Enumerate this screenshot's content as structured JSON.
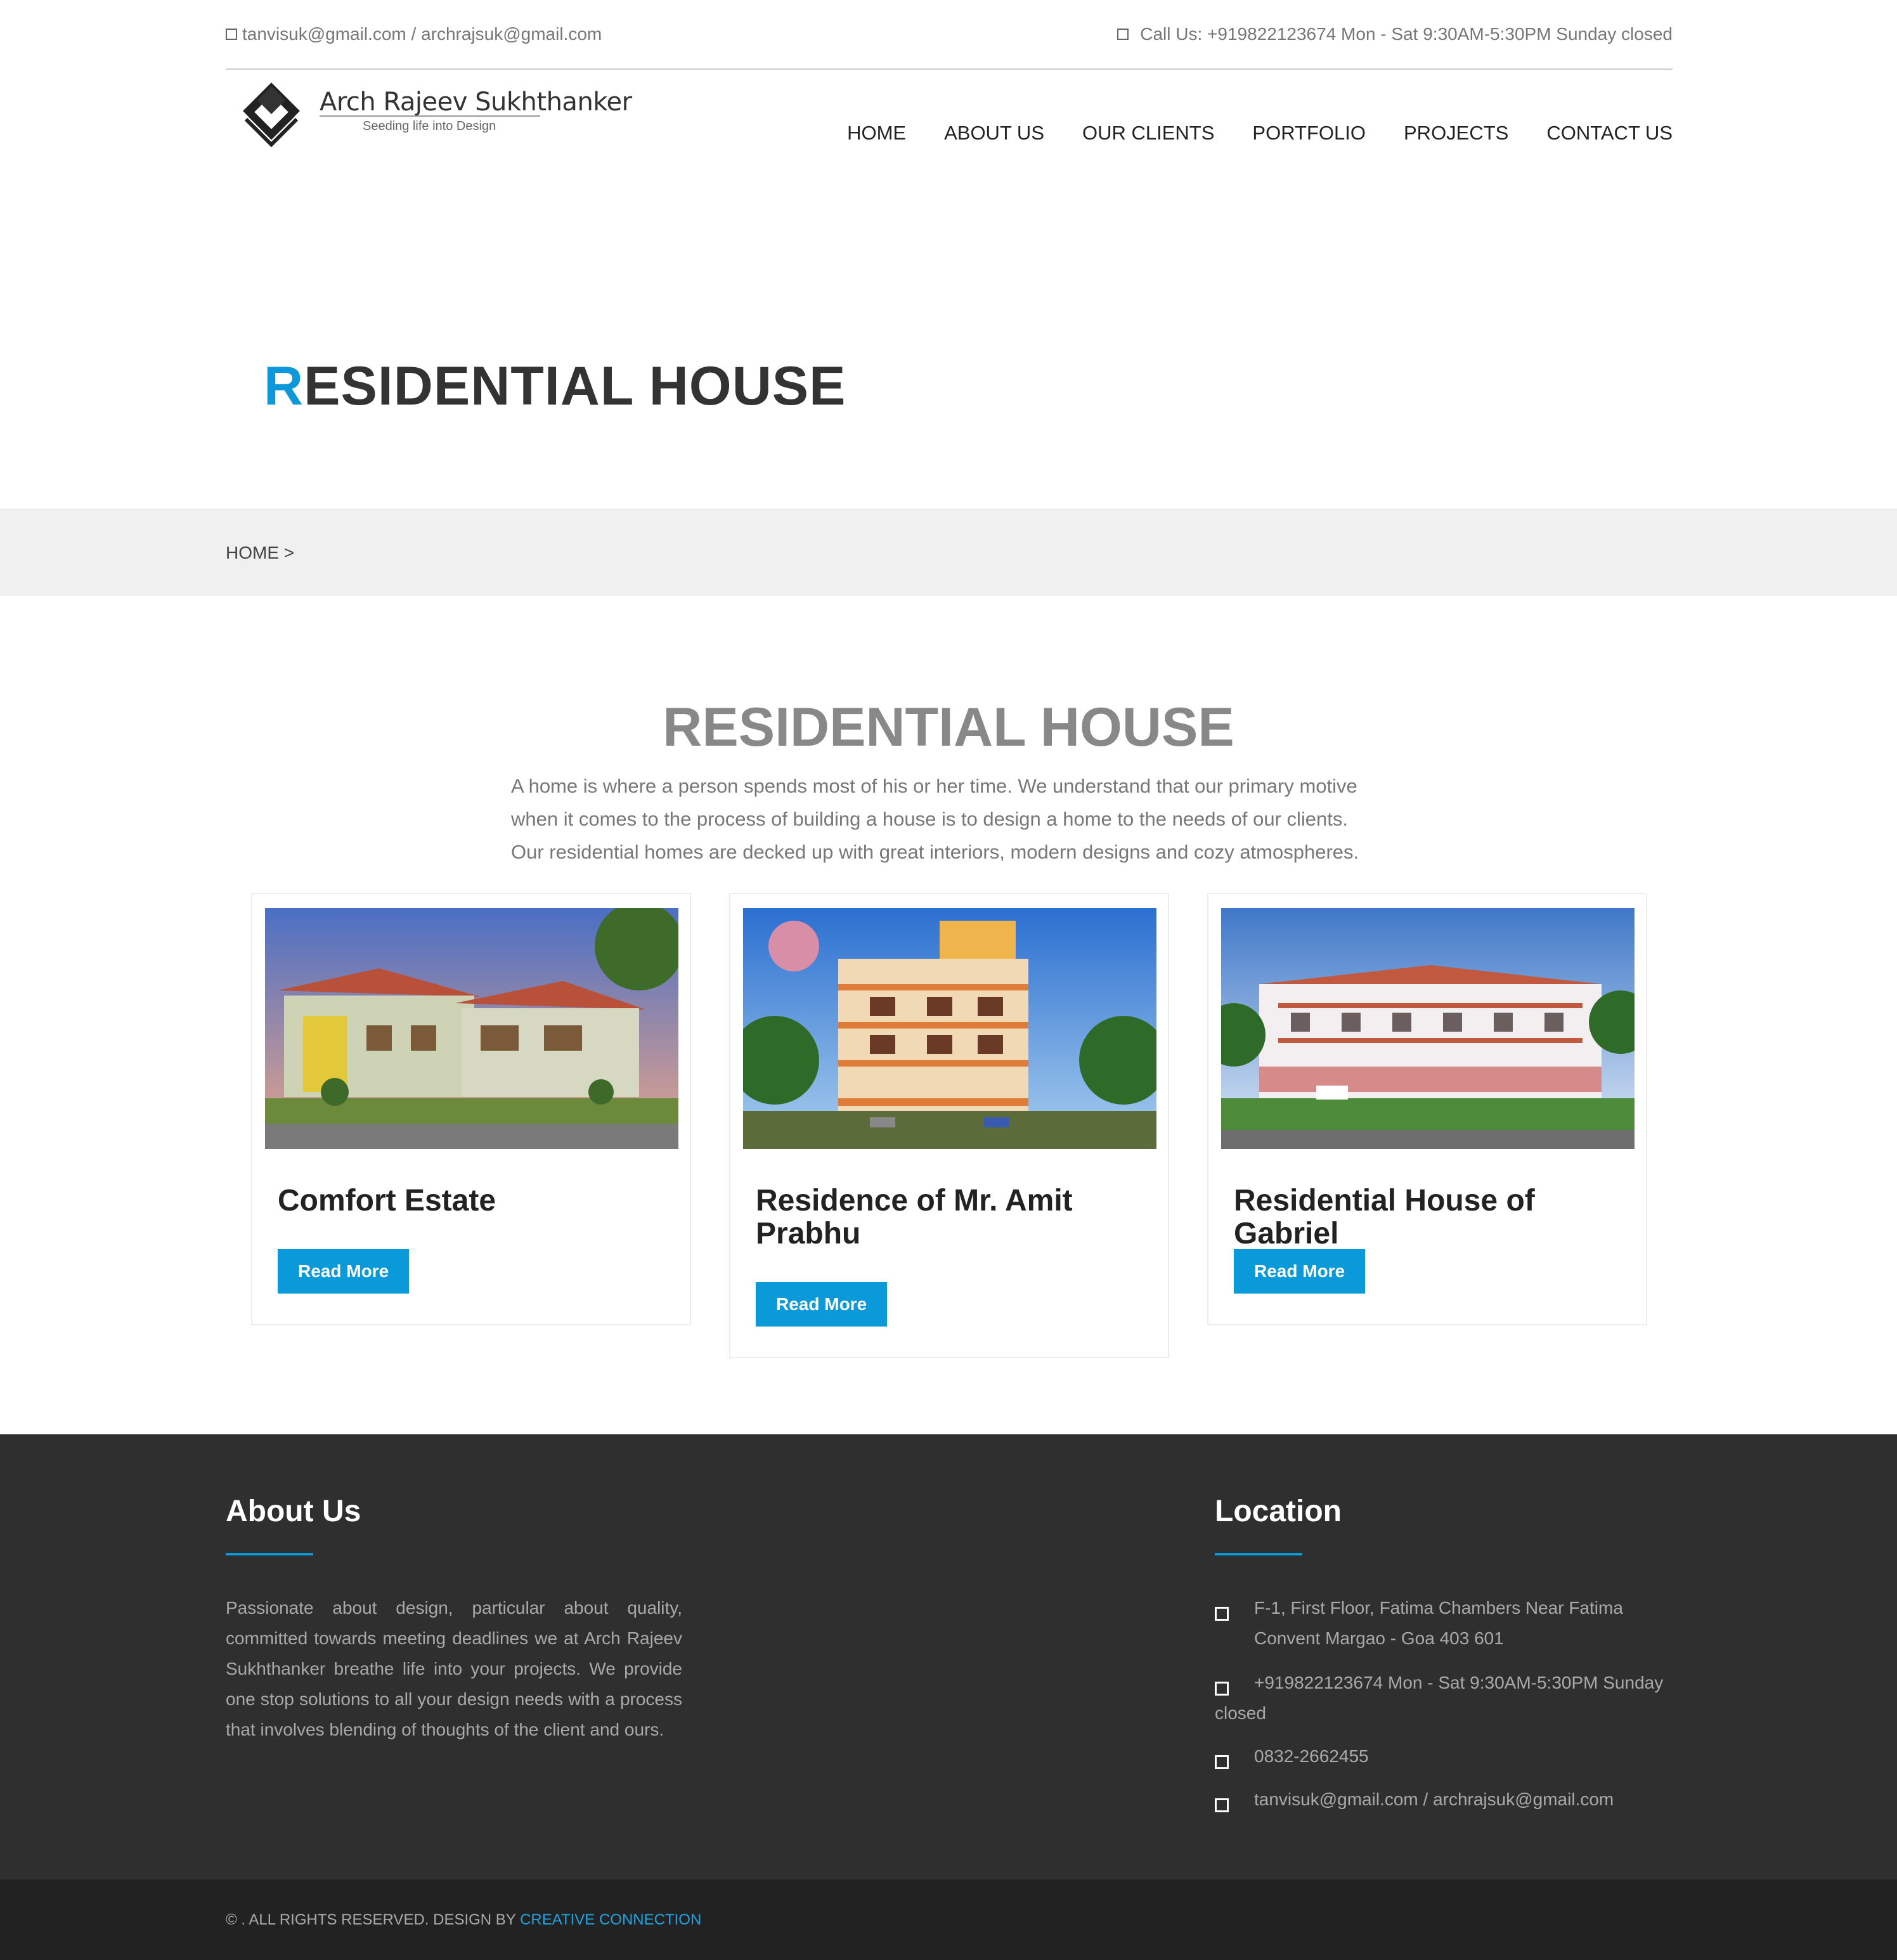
{
  "topbar": {
    "email": "tanvisuk@gmail.com / archrajsuk@gmail.com",
    "call": "Call Us: +919822123674 Mon - Sat 9:30AM-5:30PM Sunday closed"
  },
  "logo": {
    "title": "Arch Rajeev Sukhthanker",
    "tagline": "Seeding life into Design"
  },
  "nav": [
    "HOME",
    "ABOUT US",
    "OUR CLIENTS",
    "PORTFOLIO",
    "PROJECTS",
    "CONTACT US"
  ],
  "page": {
    "title_first": "R",
    "title_rest": "ESIDENTIAL HOUSE",
    "breadcrumb": "HOME >"
  },
  "section": {
    "title": "RESIDENTIAL HOUSE",
    "intro": "A home is where a person spends most of his or her time. We understand that our primary motive when it comes to the process of building a house is to design a home to the needs of our clients. Our residential homes are decked up with great interiors, modern designs and cozy atmospheres."
  },
  "cards": [
    {
      "title": "Comfort Estate",
      "button": "Read More"
    },
    {
      "title": "Residence of Mr. Amit Prabhu",
      "button": "Read More"
    },
    {
      "title": "Residential House of Gabriel",
      "button": "Read More"
    }
  ],
  "footer": {
    "about_title": "About Us",
    "about_text": "Passionate about design, particular about quality, committed towards meeting deadlines we at Arch Rajeev Sukhthanker breathe life into your projects. We provide one stop solutions to all your design needs with a process that involves blending of thoughts of the client and ours.",
    "location_title": "Location",
    "address": "F-1, First Floor, Fatima Chambers Near Fatima Convent Margao - Goa 403 601",
    "phone_hours": "+919822123674 Mon - Sat 9:30AM-5:30PM Sunday closed",
    "landline": "0832-2662455",
    "emails": "tanvisuk@gmail.com / archrajsuk@gmail.com",
    "copyright": "© . ALL RIGHTS RESERVED. DESIGN BY",
    "designer": "CREATIVE CONNECTION"
  },
  "colors": {
    "accent": "#0a9ad9",
    "footer_bg": "#2f2f2f",
    "bottom_bg": "#222222"
  }
}
